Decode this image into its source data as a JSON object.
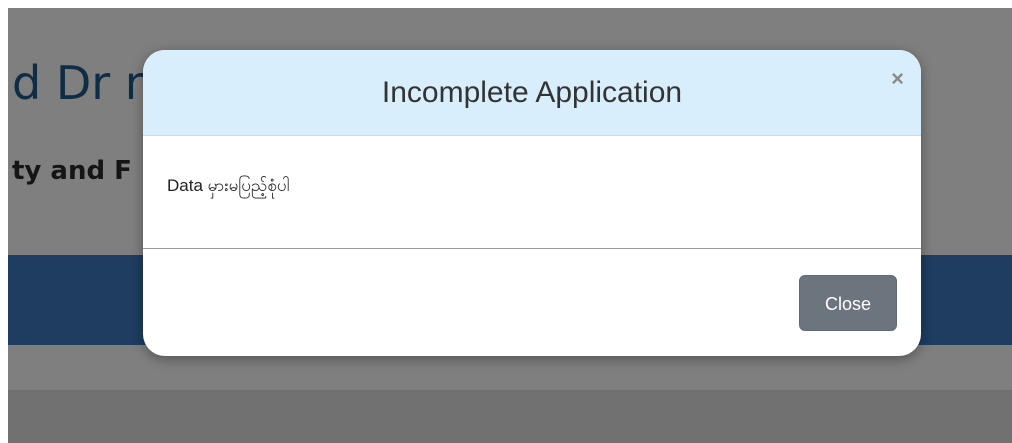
{
  "background": {
    "title": "d Dr                                                            nar",
    "subtitle": "ty and F"
  },
  "modal": {
    "title": "Incomplete Application",
    "close_icon": "×",
    "message": "Data မှားမပြည့်စုံပါ",
    "close_button_label": "Close"
  },
  "colors": {
    "header_bg": "#d8eefc",
    "button_bg": "#6c757d",
    "title_color": "#1f5a8a",
    "band_color": "#3d7ac0"
  }
}
